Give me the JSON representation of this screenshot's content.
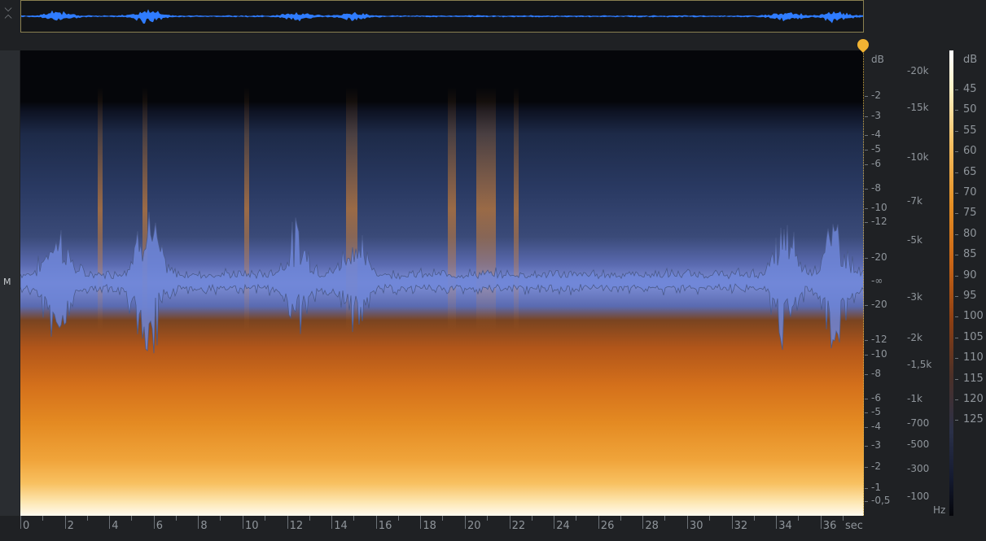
{
  "channel_label": "M",
  "db_scale": {
    "unit": "dB",
    "upper": [
      "-2",
      "-3",
      "-4",
      "-5",
      "-6",
      "-8",
      "-10",
      "-12",
      "-20"
    ],
    "center": "-∞",
    "lower": [
      "-20",
      "-12",
      "-10",
      "-8",
      "-6",
      "-5",
      "-4",
      "-3",
      "-2",
      "-1",
      "-0,5"
    ]
  },
  "freq_scale": {
    "unit": "Hz",
    "labels": [
      "-20k",
      "-15k",
      "-10k",
      "-7k",
      "-5k",
      "-3k",
      "-2k",
      "-1,5k",
      "-1k",
      "-700",
      "-500",
      "-300",
      "-100"
    ]
  },
  "colorbar": {
    "unit": "dB",
    "labels": [
      "45",
      "50",
      "55",
      "60",
      "65",
      "70",
      "75",
      "80",
      "85",
      "90",
      "95",
      "100",
      "105",
      "110",
      "115",
      "120",
      "125"
    ]
  },
  "time_axis": {
    "unit": "sec",
    "labels": [
      "0",
      "2",
      "4",
      "6",
      "8",
      "10",
      "12",
      "14",
      "16",
      "18",
      "20",
      "22",
      "24",
      "26",
      "28",
      "30",
      "32",
      "34",
      "36"
    ]
  },
  "colors": {
    "waveform": "#2f7cff",
    "waveform_overlay": "#6f86d8",
    "playhead": "#f1b333"
  },
  "icons": {
    "collapse": "chevron-up-down-icon",
    "marker": "playhead-marker-icon"
  }
}
